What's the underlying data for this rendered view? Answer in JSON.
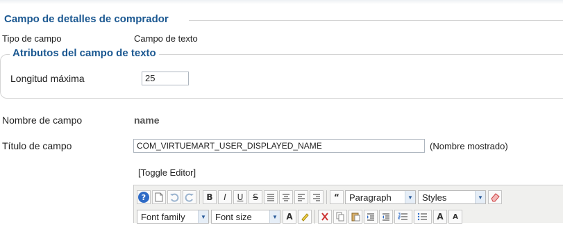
{
  "fieldset_main": {
    "title": "Campo de detalles de comprador"
  },
  "tipo_campo": {
    "label": "Tipo de campo",
    "value": "Campo de texto"
  },
  "fieldset_attrs": {
    "title": "Atributos del campo de texto",
    "max_length_label": "Longitud máxima",
    "max_length_value": "25"
  },
  "nombre_campo": {
    "label": "Nombre de campo",
    "value": "name"
  },
  "titulo_campo": {
    "label": "Título de campo",
    "value": "COM_VIRTUEMART_USER_DISPLAYED_NAME",
    "note": "(Nombre mostrado)"
  },
  "editor": {
    "toggle_label": "[Toggle Editor]",
    "row1": {
      "buttons": [
        "help-icon",
        "new-document-icon",
        "undo-icon",
        "redo-icon",
        "bold-icon",
        "italic-icon",
        "underline-icon",
        "strikethrough-icon",
        "justify-full-icon",
        "align-center-icon",
        "align-left-icon",
        "align-right-icon",
        "blockquote-icon"
      ],
      "bold_glyph": "B",
      "italic_glyph": "I",
      "underline_glyph": "U",
      "strike_glyph": "S",
      "blockquote_glyph": "“",
      "help_glyph": "?",
      "format_select": "Paragraph",
      "styles_select": "Styles"
    },
    "row2": {
      "font_family_select": "Font family",
      "font_size_select": "Font size",
      "text_color_glyph": "A",
      "font_size_up_glyph": "A",
      "font_size_down_glyph": "A"
    }
  }
}
